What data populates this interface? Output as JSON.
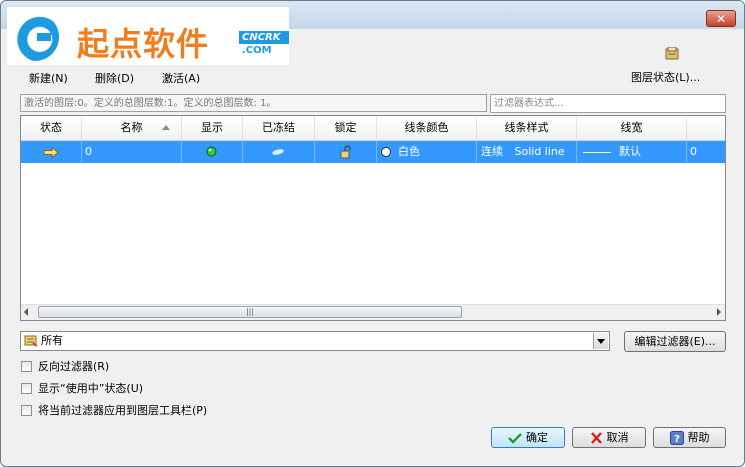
{
  "logo": {
    "text": "起点软件",
    "badge_top": "CNCRK",
    "badge_bottom": ".COM"
  },
  "window": {
    "close_glyph": "✕"
  },
  "menu": {
    "new": "新建(N)",
    "delete": "删除(D)",
    "activate": "激活(A)"
  },
  "layer_state": {
    "label": "图层状态(L)..."
  },
  "info": {
    "text": "激活的图层:0。定义的总图层数:1。定义的总图层数: 1。"
  },
  "filter_expr": {
    "placeholder": "过滤器表达式..."
  },
  "table": {
    "headers": [
      "状态",
      "名称",
      "显示",
      "已冻结",
      "锁定",
      "线条颜色",
      "线条样式",
      "线宽"
    ],
    "rows": [
      {
        "name": "0",
        "color_name": "白色",
        "style_name": "连续",
        "style_desc": "Solid line",
        "line_width": "默认",
        "extra": "0"
      }
    ]
  },
  "filter_combo": {
    "value": "所有"
  },
  "buttons": {
    "edit_filter": "编辑过滤器(E)...",
    "ok": "确定",
    "cancel": "取消",
    "help": "帮助"
  },
  "checkboxes": [
    {
      "label": "反向过滤器(R)"
    },
    {
      "label": "显示“使用中”状态(U)"
    },
    {
      "label": "将当前过滤器应用到图层工具栏(P)"
    }
  ],
  "colors": {
    "selection": "#3399ff",
    "logo_orange": "#f07d1e",
    "logo_blue": "#1e9be0"
  }
}
